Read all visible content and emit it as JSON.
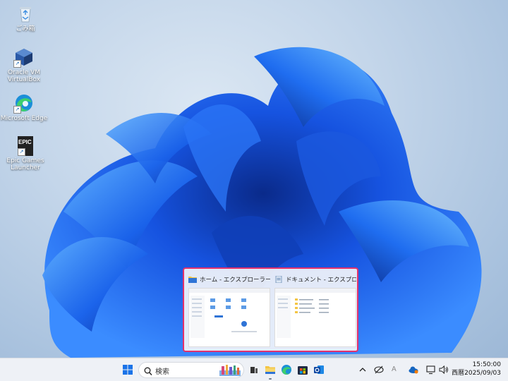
{
  "desktop": {
    "icons": [
      {
        "label": "ごみ箱",
        "icon": "recycle-bin-icon"
      },
      {
        "label": "Oracle VM VirtualBox",
        "icon": "virtualbox-icon"
      },
      {
        "label": "Microsoft Edge",
        "icon": "edge-icon"
      },
      {
        "label": "Epic Games Launcher",
        "icon": "epic-games-icon",
        "logo_text": "EPIC"
      }
    ]
  },
  "switcher": {
    "windows": [
      {
        "title": "ホーム - エクスプローラー",
        "icon": "folder-icon"
      },
      {
        "title": "ドキュメント - エクスプローラー",
        "icon": "document-icon"
      }
    ],
    "highlight_color": "#e2316d"
  },
  "taskbar": {
    "search_placeholder": "検索",
    "pinned": [
      "start-icon",
      "task-view-icon",
      "file-explorer-icon",
      "edge-icon",
      "store-icon",
      "outlook-icon"
    ],
    "tray": [
      "chevron-up-icon",
      "network-icon",
      "ime-icon",
      "onedrive-icon",
      "display-icon",
      "volume-icon"
    ],
    "ime_label": "A",
    "time": "15:50:00",
    "date": "西暦2025/09/03"
  }
}
